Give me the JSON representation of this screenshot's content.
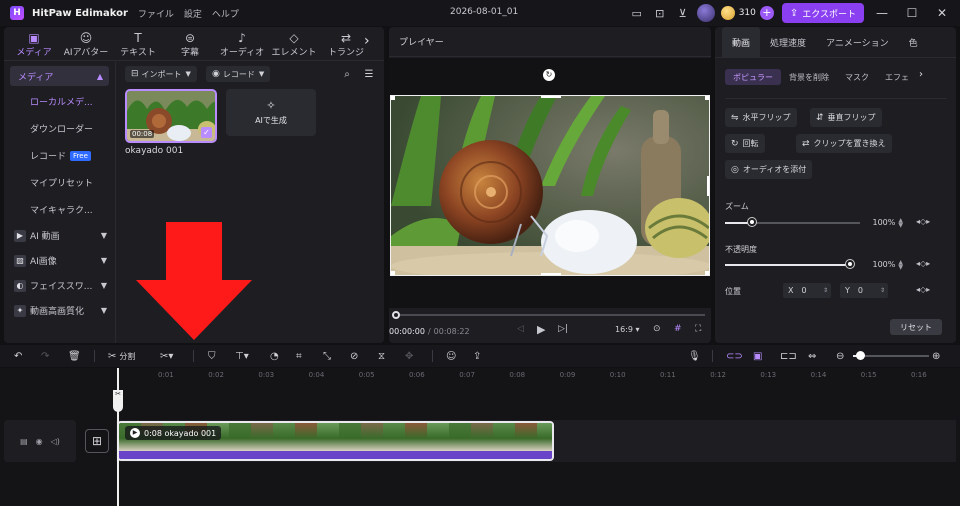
{
  "titlebar": {
    "app_name": "HitPaw Edimakor",
    "menus": [
      "ファイル",
      "設定",
      "ヘルプ"
    ],
    "project_title": "2026-08-01_01",
    "credits": "310",
    "export_label": "エクスポート"
  },
  "media_tabs": [
    {
      "label": "メディア",
      "icon": "media-icon",
      "active": true
    },
    {
      "label": "AIアバター",
      "icon": "avatar-icon",
      "active": false
    },
    {
      "label": "テキスト",
      "icon": "text-icon",
      "active": false
    },
    {
      "label": "字幕",
      "icon": "subtitle-icon",
      "active": false
    },
    {
      "label": "オーディオ",
      "icon": "audio-icon",
      "active": false
    },
    {
      "label": "エレメント",
      "icon": "element-icon",
      "active": false
    },
    {
      "label": "トランジ",
      "icon": "transition-icon",
      "active": false
    }
  ],
  "sidebar": {
    "header": "メディア",
    "items": [
      "ローカルメデ...",
      "ダウンローダー",
      "レコード",
      "マイプリセット",
      "マイキャラク..."
    ],
    "free_badge": "Free",
    "groups": [
      "AI 動画",
      "AI画像",
      "フェイススワ...",
      "動画高画質化"
    ]
  },
  "media_content": {
    "import_label": "インポート",
    "record_label": "レコード",
    "clip_duration": "00:08",
    "clip_name": "okayado 001",
    "ai_generate_label": "AIで生成"
  },
  "player": {
    "title": "プレイヤー",
    "current_time": "00:00:00",
    "separator": "/",
    "total_time": "00:08:22",
    "aspect_ratio": "16:9",
    "progress": 0
  },
  "properties": {
    "tabs": [
      "動画",
      "処理速度",
      "アニメーション",
      "色"
    ],
    "subtabs": [
      "ポピュラー",
      "背景を削除",
      "マスク",
      "エフェ"
    ],
    "buttons": [
      "水平フリップ",
      "垂直フリップ",
      "回転",
      "クリップを置き換え",
      "オーディオを添付"
    ],
    "zoom_label": "ズーム",
    "zoom_value": "100%",
    "zoom_level": 0.2,
    "opacity_label": "不透明度",
    "opacity_value": "100%",
    "opacity_level": 1.0,
    "position_label": "位置",
    "pos_x_label": "X",
    "pos_x": "0",
    "pos_y_label": "Y",
    "pos_y": "0",
    "reset_label": "リセット"
  },
  "toolbar": {
    "split_label": "分割"
  },
  "timeline": {
    "ticks": [
      "0:01",
      "0:02",
      "0:03",
      "0:04",
      "0:05",
      "0:06",
      "0:07",
      "0:08",
      "0:09",
      "0:10",
      "0:11",
      "0:12",
      "0:13",
      "0:14",
      "0:15",
      "0:16"
    ],
    "clip_duration": "0:08",
    "clip_name": "okayado 001"
  },
  "colors": {
    "accent": "#b98cff",
    "export": "#8a3ff0",
    "annotation_arrow": "#ff1a1a"
  }
}
